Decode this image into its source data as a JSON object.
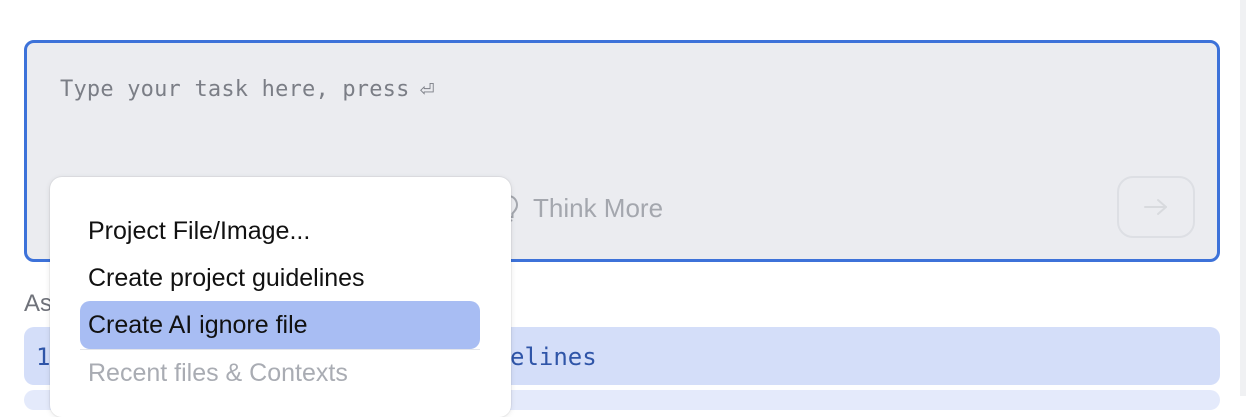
{
  "task_input": {
    "placeholder": "Type your task here, press",
    "enter_glyph": "⏎"
  },
  "think_more": {
    "label": "Think More",
    "icon": "lightbulb-icon"
  },
  "send_button": {
    "icon": "arrow-right-icon"
  },
  "background_label": "As",
  "suggestion_row": {
    "prefix": "1",
    "text": "elines"
  },
  "popup": {
    "items": [
      {
        "label": "Project File/Image..."
      },
      {
        "label": "Create project guidelines"
      },
      {
        "label": "Create AI ignore file"
      }
    ],
    "selected_index": 2,
    "section_header": "Recent files & Contexts"
  },
  "colors": {
    "focus_border": "#3d72d9",
    "input_bg": "#ebecf0",
    "selected_item_bg": "#a8bdf3",
    "row_bg": "#d4def9"
  }
}
